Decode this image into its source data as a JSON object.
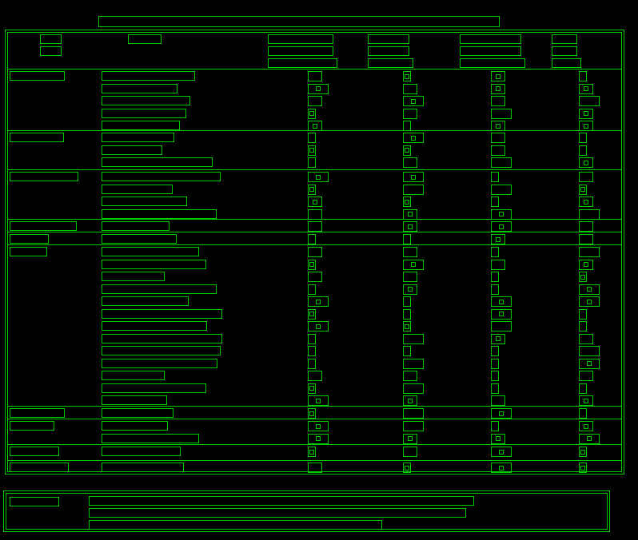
{
  "document": {
    "title": "",
    "notes_label": "",
    "notes_lines": [
      "",
      "",
      ""
    ]
  },
  "table": {
    "headers": [
      "",
      "",
      "",
      "",
      "",
      ""
    ],
    "sections": [
      {
        "label": "",
        "rows": 5
      },
      {
        "label": "",
        "rows": 3
      },
      {
        "label": "",
        "rows": 4
      },
      {
        "label": "",
        "rows": 1
      },
      {
        "label": "",
        "rows": 1
      },
      {
        "label": "",
        "rows": 13
      },
      {
        "label": "",
        "rows": 1
      },
      {
        "label": "",
        "rows": 2
      },
      {
        "label": "",
        "rows": 1
      },
      {
        "label": "",
        "rows": 1
      }
    ]
  }
}
